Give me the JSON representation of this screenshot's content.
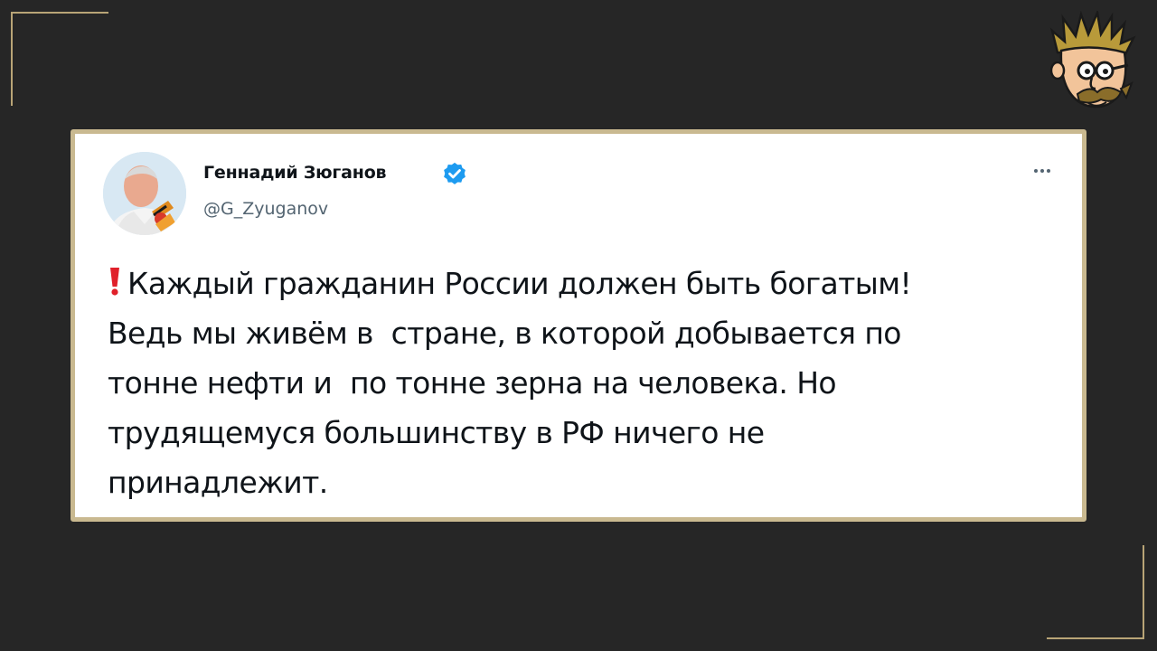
{
  "tweet": {
    "author_name": "Геннадий Зюганов",
    "author_handle": "@G_Zyuganov",
    "verified": true,
    "lines": [
      "Каждый гражданин России должен быть богатым!",
      "Ведь мы живём в  стране, в которой добывается по",
      "тонне нефти и  по тонне зерна на человека. Но",
      "трудящемуся большинству в РФ ничего не",
      "принадлежит."
    ],
    "leading_icon": "red-exclamation-icon"
  },
  "icons": {
    "verified": "verified-badge-icon",
    "more": "more-options-icon",
    "logo": "cartoon-face-logo"
  },
  "colors": {
    "background": "#262626",
    "accent_gold": "#c9b990",
    "verified_blue": "#1d9bf0",
    "exclamation_red": "#e0202a"
  }
}
